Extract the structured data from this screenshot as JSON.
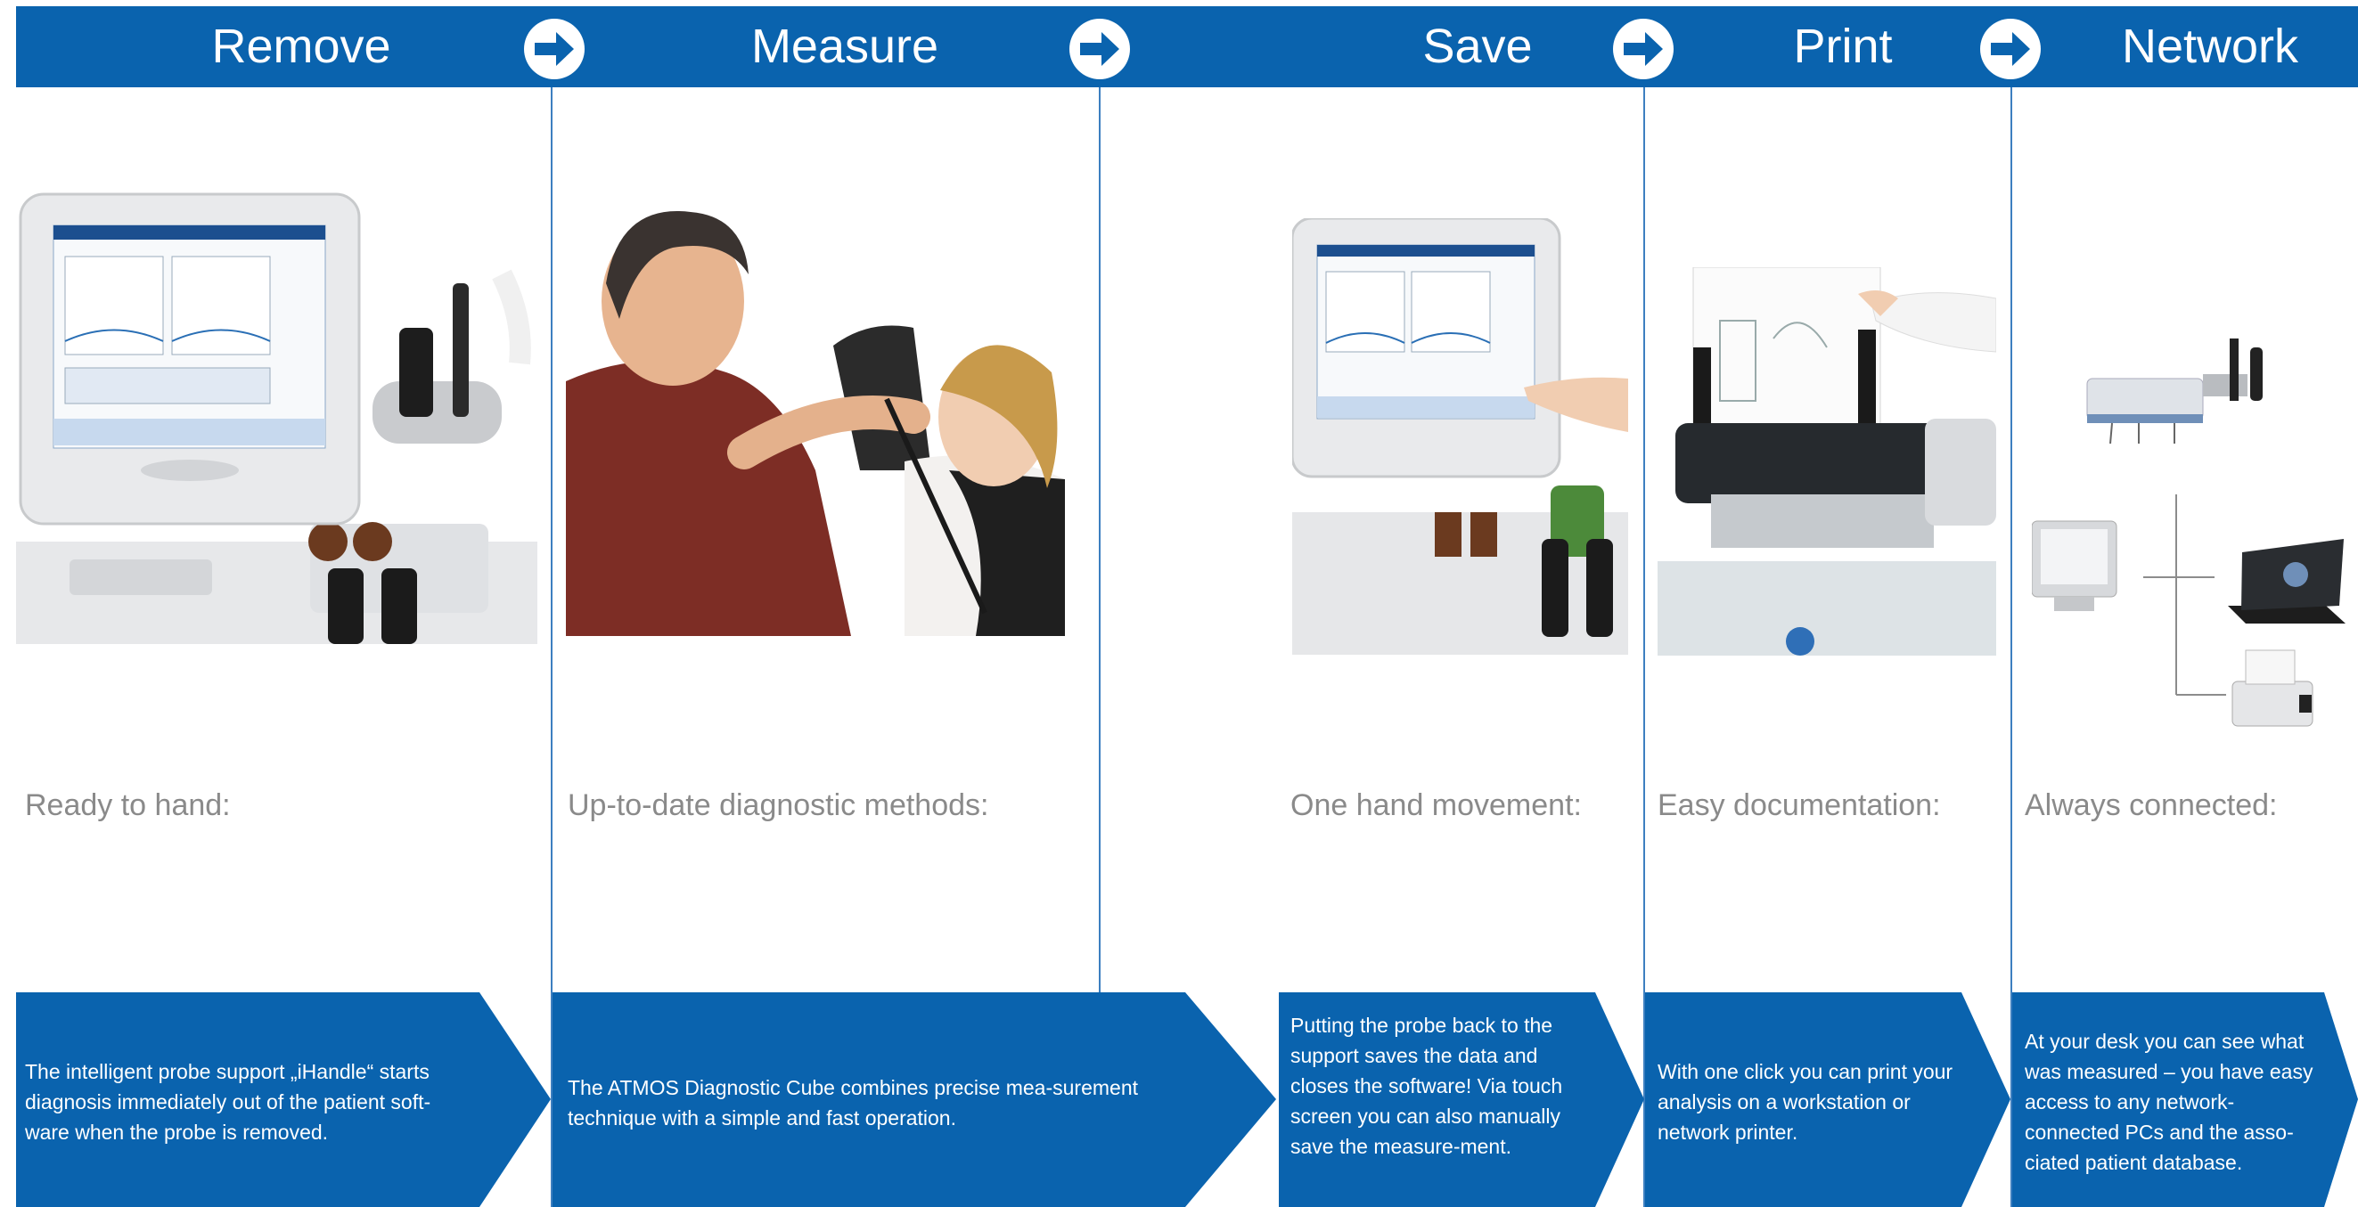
{
  "steps": [
    {
      "title": "Remove",
      "lead": "Ready to hand:",
      "text": "The intelligent probe support „iHandle“ starts diagnosis immediately out of the patient soft-ware when the probe is removed."
    },
    {
      "title": "Measure",
      "lead": "Up-to-date diagnostic methods:",
      "text": "The ATMOS Diagnostic Cube combines precise mea-surement technique with a simple and fast operation."
    },
    {
      "title": "Save",
      "lead": "One hand movement:",
      "text": "Putting the probe back to the support saves the data and closes the software! Via touch screen you can also manually save the measure-ment."
    },
    {
      "title": "Print",
      "lead": "Easy documentation:",
      "text": "With one click you can print your analysis on a workstation or network printer."
    },
    {
      "title": "Network",
      "lead": "Always connected:",
      "text": "At your desk you can see what was measured – you have easy access to any network-connected PCs and the asso-ciated patient database."
    }
  ],
  "colors": {
    "brand_blue": "#0a63ae",
    "lead_gray": "#8a8a8a",
    "divider": "#3d7fc0"
  },
  "icons": [
    "arrow-right-circle-icon"
  ]
}
